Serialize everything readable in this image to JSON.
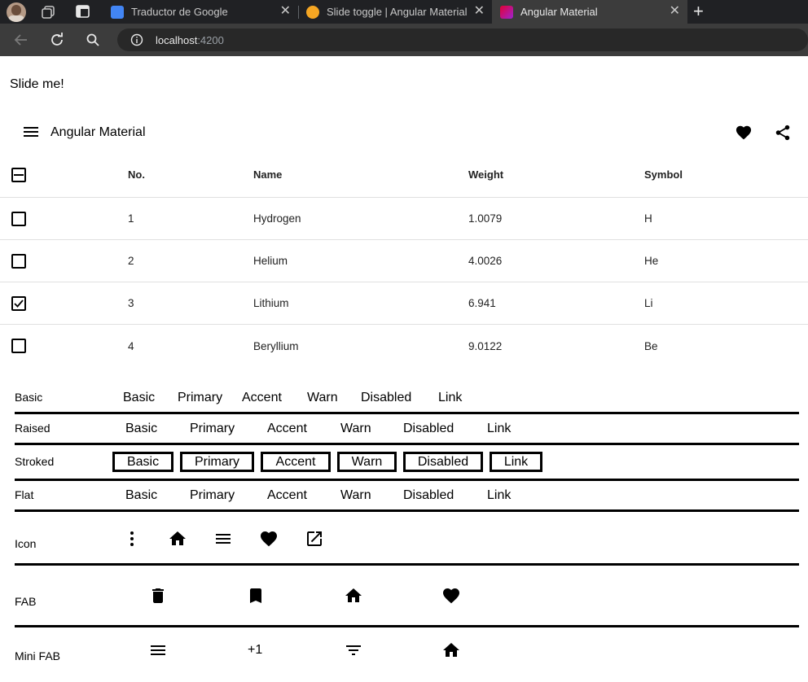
{
  "browser": {
    "tabs": [
      {
        "title": "Traductor de Google"
      },
      {
        "title": "Slide toggle | Angular Material"
      },
      {
        "title": "Angular Material"
      }
    ],
    "url_host": "localhost",
    "url_port": ":4200"
  },
  "page": {
    "slide_label": "Slide me!",
    "toolbar_title": "Angular Material",
    "table": {
      "headers": [
        "No.",
        "Name",
        "Weight",
        "Symbol"
      ],
      "rows": [
        {
          "no": "1",
          "name": "Hydrogen",
          "weight": "1.0079",
          "symbol": "H",
          "checked": false
        },
        {
          "no": "2",
          "name": "Helium",
          "weight": "4.0026",
          "symbol": "He",
          "checked": false
        },
        {
          "no": "3",
          "name": "Lithium",
          "weight": "6.941",
          "symbol": "Li",
          "checked": true
        },
        {
          "no": "4",
          "name": "Beryllium",
          "weight": "9.0122",
          "symbol": "Be",
          "checked": false
        }
      ]
    },
    "buttons": {
      "basic_label": "Basic",
      "raised_label": "Raised",
      "stroked_label": "Stroked",
      "flat_label": "Flat",
      "icon_label": "Icon",
      "fab_label": "FAB",
      "minifab_label": "Mini FAB",
      "b_basic": "Basic",
      "b_primary": "Primary",
      "b_accent": "Accent",
      "b_warn": "Warn",
      "b_disabled": "Disabled",
      "b_link": "Link",
      "minifab_plus_one": "+1"
    },
    "icons": {
      "toolbar": [
        "menu-icon",
        "favorite-icon",
        "share-icon"
      ],
      "icon_row": [
        "more-vert-icon",
        "home-icon",
        "menu-icon",
        "favorite-icon",
        "open-in-new-icon"
      ],
      "fab_row": [
        "delete-icon",
        "bookmark-icon",
        "home-icon",
        "favorite-icon"
      ],
      "minifab_row": [
        "menu-icon",
        "plus-one-icon",
        "filter-list-icon",
        "home-icon"
      ]
    }
  }
}
